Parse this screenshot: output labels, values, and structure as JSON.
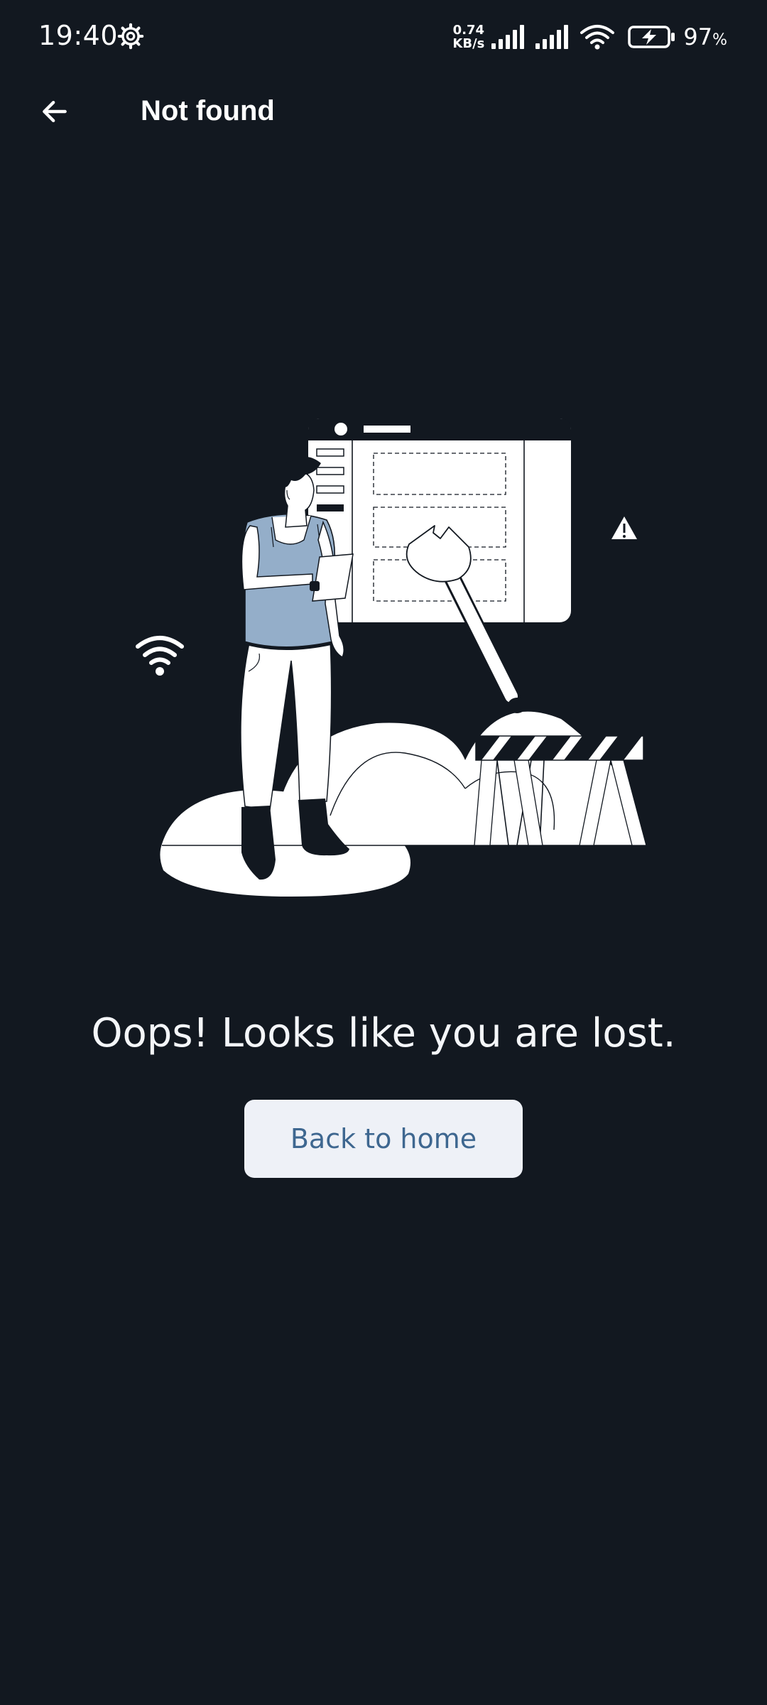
{
  "status_bar": {
    "time": "19:40",
    "net_speed_value": "0.74",
    "net_speed_unit": "KB/s",
    "battery_percent": "97",
    "battery_unit": "%"
  },
  "app_bar": {
    "title": "Not found"
  },
  "content": {
    "message": "Oops! Looks like you are lost.",
    "back_button_label": "Back to home"
  },
  "colors": {
    "background": "#121820",
    "button_bg": "#eef1f7",
    "button_text": "#3e6790",
    "accent_blue": "#94aec9"
  }
}
